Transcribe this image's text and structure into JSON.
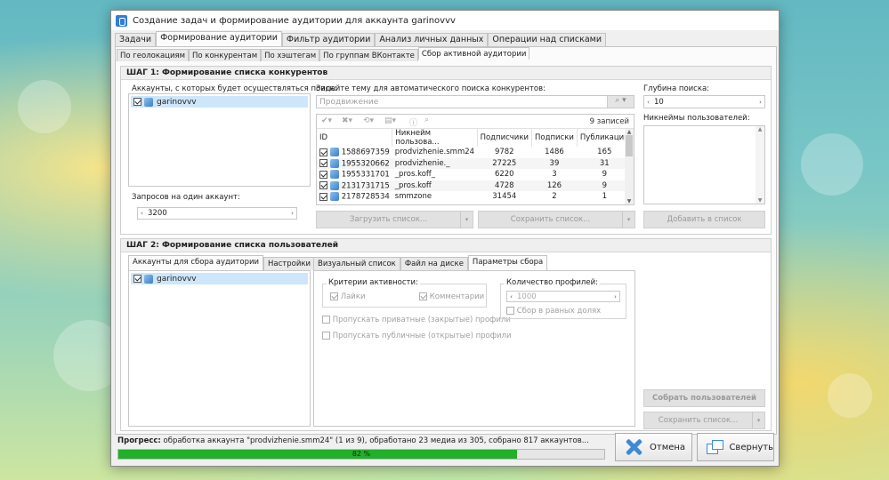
{
  "window": {
    "title": "Создание задач и формирование аудитории для аккаунта garinovvv"
  },
  "main_tabs": [
    "Задачи",
    "Формирование аудитории",
    "Фильтр аудитории",
    "Анализ личных данных",
    "Операции над списками"
  ],
  "sub_tabs": [
    "По геолокациям",
    "По конкурентам",
    "По хэштегам",
    "По группам ВКонтакте",
    "Сбор активной аудитории"
  ],
  "step1": {
    "title": "ШАГ 1: Формирование списка конкурентов",
    "accounts_label": "Аккаунты, с которых будет осуществляться поиск:",
    "accounts": [
      "garinovvv"
    ],
    "requests_label": "Запросов на один аккаунт:",
    "requests_value": "3200",
    "topic_label": "Задайте тему для автоматического поиска конкурентов:",
    "topic_placeholder": "Продвижение",
    "records": "9 записей",
    "columns": [
      "ID",
      "Никнейм пользова...",
      "Подписчики",
      "Подписки",
      "Публикации"
    ],
    "rows": [
      {
        "id": "1588697359",
        "nick": "prodvizhenie.smm24",
        "followers": "9782",
        "following": "1486",
        "posts": "165"
      },
      {
        "id": "1955320662",
        "nick": "prodvizhenie._",
        "followers": "27225",
        "following": "39",
        "posts": "31"
      },
      {
        "id": "1955331701",
        "nick": "_pros.koff_",
        "followers": "6220",
        "following": "3",
        "posts": "9"
      },
      {
        "id": "2131731715",
        "nick": "_pros.koff",
        "followers": "4728",
        "following": "126",
        "posts": "9"
      },
      {
        "id": "2178728534",
        "nick": "smmzone",
        "followers": "31454",
        "following": "2",
        "posts": "1"
      }
    ],
    "load_list": "Загрузить список...",
    "save_list": "Сохранить список...",
    "depth_label": "Глубина поиска:",
    "depth_value": "10",
    "nicknames_label": "Никнеймы пользователей:",
    "add_to_list": "Добавить в список"
  },
  "step2": {
    "title": "ШАГ 2: Формирование списка пользователей",
    "left_tabs": [
      "Аккаунты для сбора аудитории",
      "Настройки"
    ],
    "accounts": [
      "garinovvv"
    ],
    "right_tabs": [
      "Визуальный список",
      "Файл на диске",
      "Параметры сбора"
    ],
    "criteria_label": "Критерии активности:",
    "likes": "Лайки",
    "comments": "Комментарии",
    "skip_private": "Пропускать приватные (закрытые) профили",
    "skip_public": "Пропускать публичные (открытые) профили",
    "profiles_label": "Количество профилей:",
    "profiles_value": "1000",
    "equal_shares": "Сбор в равных долях",
    "collect_users": "Собрать пользователей",
    "save_list": "Сохранить список..."
  },
  "footer": {
    "progress_label": "Прогресс:",
    "progress_text": "обработка аккаунта \"prodvizhenie.smm24\" (1 из 9), обработано 23 медиа из 305, собрано 817 аккаунтов...",
    "progress_percent": "82 %",
    "progress_value": 0.82,
    "cancel": "Отмена",
    "minimize": "Свернуть"
  },
  "colors": {
    "progress": "#22b02a",
    "accent": "#3d8ad8"
  }
}
